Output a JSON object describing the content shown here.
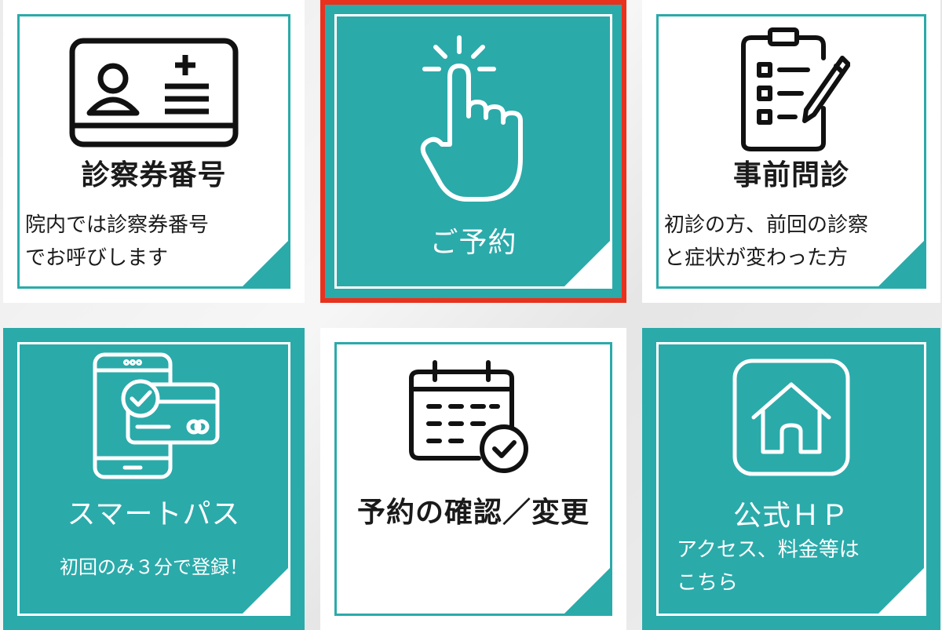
{
  "tiles": [
    {
      "id": "card-number",
      "title": "診察券番号",
      "desc_lines": [
        "院内では診察券番号",
        "でお呼びします"
      ],
      "theme": "light",
      "icon": "id-card-icon"
    },
    {
      "id": "reservation",
      "title": "ご予約",
      "desc_lines": [],
      "theme": "dark",
      "icon": "tap-hand-icon",
      "highlighted": true
    },
    {
      "id": "pre-consultation",
      "title": "事前問診",
      "desc_lines": [
        "初診の方、前回の診察",
        "と症状が変わった方"
      ],
      "theme": "light",
      "icon": "clipboard-pencil-icon"
    },
    {
      "id": "smart-pass",
      "title": "スマートパス",
      "desc_lines": [
        "初回のみ３分で登録！"
      ],
      "theme": "dark",
      "icon": "phone-card-icon"
    },
    {
      "id": "confirm-change",
      "title": "予約の確認／変更",
      "desc_lines": [],
      "theme": "light",
      "icon": "calendar-check-icon"
    },
    {
      "id": "official-hp",
      "title": "公式ＨＰ",
      "desc_lines": [
        "アクセス、料金等は",
        "こちら"
      ],
      "theme": "dark",
      "icon": "home-icon"
    }
  ],
  "colors": {
    "teal": "#2baaaa",
    "white": "#ffffff",
    "highlight": "#e8321e"
  }
}
